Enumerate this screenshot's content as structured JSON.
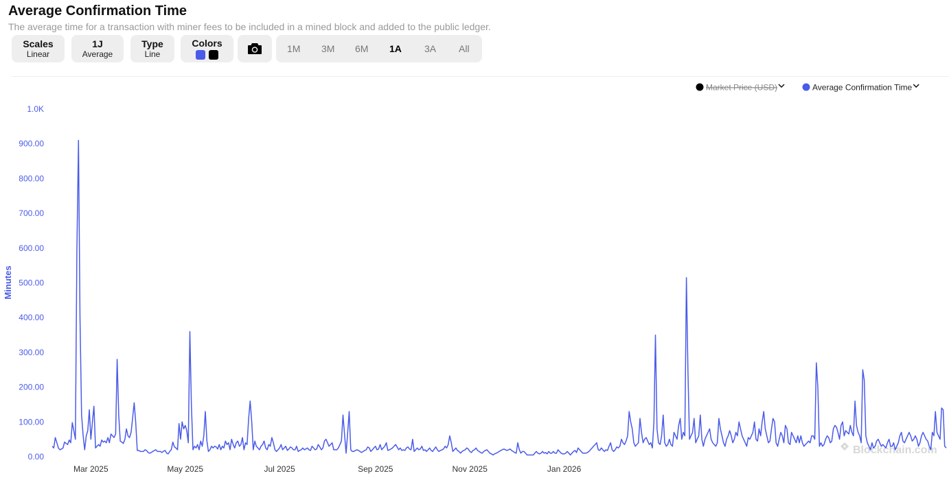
{
  "header": {
    "title": "Average Confirmation Time",
    "subtitle": "The average time for a transaction with miner fees to be included in a mined block and added to the public ledger."
  },
  "toolbar": {
    "scales": {
      "label": "Scales",
      "value": "Linear"
    },
    "average": {
      "label": "1J",
      "value": "Average"
    },
    "type": {
      "label": "Type",
      "value": "Line"
    },
    "colors": {
      "label": "Colors",
      "swatch1": "#4a5be8",
      "swatch2": "#000000"
    },
    "camera_icon": "camera-icon",
    "ranges": [
      "1M",
      "3M",
      "6M",
      "1A",
      "3A",
      "All"
    ],
    "active_range": "1A"
  },
  "legend": [
    {
      "label": "Market Price (USD)",
      "color": "#000000",
      "disabled": true
    },
    {
      "label": "Average Confirmation Time",
      "color": "#4a5be8",
      "disabled": false
    }
  ],
  "watermark": "Blockchain.com",
  "chart_data": {
    "type": "line",
    "ylabel": "Minutes",
    "ylim": [
      0,
      1000
    ],
    "y_ticks": [
      "0.00",
      "100.00",
      "200.00",
      "300.00",
      "400.00",
      "500.00",
      "600.00",
      "700.00",
      "800.00",
      "900.00",
      "1.0K"
    ],
    "x_ticks": [
      "Mar 2025",
      "May 2025",
      "Jul 2025",
      "Sep 2025",
      "Nov 2025",
      "Jan 2026"
    ],
    "series": [
      {
        "name": "Average Confirmation Time",
        "color": "#4a5be8",
        "x_start": "2025-02-04",
        "x_step_days": 1,
        "values": [
          30,
          25,
          55,
          40,
          25,
          20,
          22,
          25,
          42,
          38,
          35,
          48,
          40,
          98,
          75,
          50,
          600,
          910,
          400,
          120,
          60,
          20,
          60,
          75,
          135,
          50,
          100,
          145,
          25,
          30,
          35,
          30,
          48,
          42,
          45,
          40,
          55,
          40,
          65,
          60,
          55,
          65,
          280,
          120,
          45,
          42,
          38,
          50,
          80,
          60,
          55,
          70,
          110,
          155,
          100,
          18,
          18,
          15,
          15,
          15,
          20,
          18,
          12,
          10,
          12,
          15,
          18,
          20,
          15,
          15,
          15,
          12,
          16,
          18,
          10,
          8,
          15,
          20,
          42,
          28,
          25,
          20,
          95,
          50,
          100,
          80,
          90,
          75,
          40,
          360,
          150,
          20,
          30,
          25,
          35,
          20,
          45,
          30,
          60,
          130,
          45,
          15,
          20,
          30,
          25,
          30,
          28,
          22,
          35,
          20,
          30,
          25,
          45,
          35,
          40,
          20,
          50,
          35,
          25,
          40,
          45,
          30,
          35,
          55,
          20,
          40,
          35,
          110,
          160,
          100,
          20,
          45,
          30,
          25,
          20,
          30,
          35,
          45,
          25,
          20,
          35,
          30,
          55,
          40,
          20,
          15,
          20,
          25,
          35,
          20,
          25,
          30,
          18,
          22,
          28,
          25,
          20,
          20,
          30,
          15,
          18,
          20,
          25,
          20,
          22,
          25,
          20,
          18,
          30,
          25,
          20,
          22,
          35,
          28,
          20,
          25,
          45,
          50,
          40,
          30,
          35,
          40,
          20,
          20,
          20,
          25,
          35,
          45,
          120,
          65,
          10,
          65,
          130,
          20,
          15,
          15,
          18,
          20,
          18,
          15,
          12,
          15,
          18,
          20,
          28,
          25,
          15,
          20,
          25,
          30,
          20,
          22,
          35,
          20,
          25,
          30,
          40,
          18,
          20,
          22,
          25,
          30,
          35,
          28,
          20,
          25,
          18,
          20,
          18,
          25,
          28,
          22,
          20,
          50,
          15,
          20,
          25,
          20,
          22,
          30,
          18,
          20,
          15,
          20,
          25,
          18,
          15,
          22,
          28,
          20,
          15,
          18,
          20,
          22,
          30,
          25,
          35,
          60,
          40,
          15,
          20,
          25,
          18,
          15,
          10,
          15,
          18,
          20,
          25,
          22,
          15,
          12,
          18,
          20,
          25,
          18,
          15,
          12,
          10,
          15,
          18,
          20,
          15,
          10,
          8,
          5,
          8,
          10,
          12,
          15,
          18,
          20,
          22,
          20,
          18,
          20,
          22,
          18,
          15,
          12,
          10,
          40,
          20,
          10,
          15,
          15,
          10,
          5,
          5,
          5,
          5,
          5,
          10,
          15,
          10,
          8,
          10,
          15,
          10,
          12,
          8,
          15,
          10,
          10,
          15,
          10,
          10,
          20,
          15,
          10,
          8,
          8,
          10,
          15,
          10,
          5,
          10,
          15,
          18,
          12,
          25,
          20,
          15,
          10,
          10,
          10,
          12,
          15,
          20,
          25,
          30,
          35,
          40,
          20,
          18,
          25,
          20,
          15,
          20,
          18,
          30,
          40,
          20,
          15,
          20,
          28,
          25,
          30,
          50,
          40,
          35,
          45,
          60,
          130,
          100,
          80,
          40,
          30,
          35,
          40,
          110,
          70,
          40,
          50,
          55,
          45,
          35,
          40,
          25,
          100,
          350,
          80,
          40,
          35,
          60,
          120,
          40,
          30,
          35,
          50,
          35,
          30,
          70,
          60,
          50,
          90,
          110,
          50,
          70,
          60,
          515,
          250,
          50,
          60,
          70,
          110,
          40,
          50,
          60,
          120,
          50,
          30,
          50,
          60,
          70,
          80,
          50,
          40,
          35,
          30,
          40,
          110,
          80,
          60,
          40,
          30,
          50,
          60,
          75,
          60,
          40,
          50,
          70,
          60,
          100,
          80,
          60,
          50,
          40,
          30,
          55,
          50,
          60,
          70,
          100,
          50,
          45,
          80,
          60,
          100,
          130,
          80,
          60,
          40,
          45,
          80,
          110,
          100,
          40,
          30,
          50,
          70,
          60,
          40,
          90,
          80,
          40,
          35,
          70,
          60,
          50,
          40,
          60,
          40,
          60,
          40,
          30,
          35,
          40,
          45,
          40,
          60,
          60,
          50,
          270,
          200,
          30,
          40,
          30,
          35,
          50,
          60,
          55,
          40,
          45,
          80,
          90,
          85,
          70,
          50,
          90,
          100,
          60,
          75,
          70,
          65,
          90,
          70,
          60,
          160,
          90,
          70,
          60,
          40,
          250,
          220,
          60,
          40,
          30,
          20,
          40,
          25,
          30,
          45,
          50,
          40,
          30,
          35,
          30,
          25,
          40,
          50,
          30,
          30,
          40,
          20,
          30,
          40,
          60,
          70,
          45,
          40,
          50,
          60,
          70,
          60,
          45,
          50,
          60,
          50,
          30,
          40,
          60,
          70,
          60,
          50,
          45,
          30,
          20,
          70,
          60,
          130,
          70,
          60,
          50,
          140,
          135,
          30,
          25
        ]
      }
    ]
  }
}
